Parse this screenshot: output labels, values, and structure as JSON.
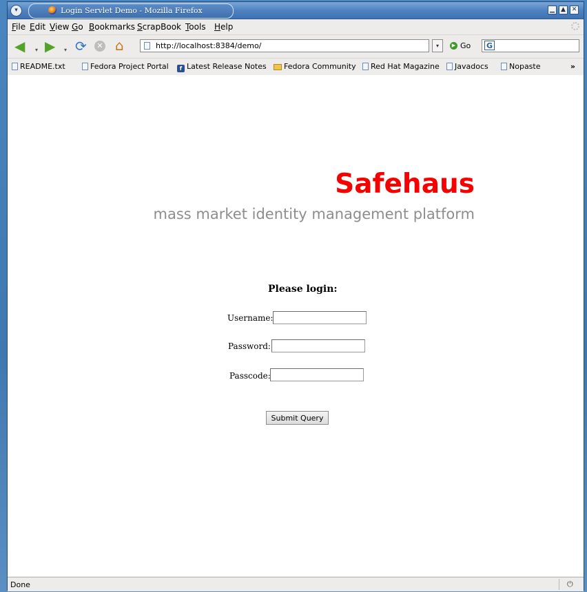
{
  "window": {
    "title": "Login Servlet Demo - Mozilla Firefox",
    "buttons": {
      "minimize": "▁",
      "maximize": "▲",
      "close": "✕"
    }
  },
  "menubar": [
    "File",
    "Edit",
    "View",
    "Go",
    "Bookmarks",
    "ScrapBook",
    "Tools",
    "Help"
  ],
  "navbar": {
    "url": "http://localhost:8384/demo/",
    "go_label": "Go",
    "icons": {
      "back": "◀",
      "forward": "▶",
      "reload": "⟳",
      "stop": "✕",
      "home": "⌂",
      "dropdown": "▾"
    }
  },
  "bookmarks": [
    {
      "label": "README.txt",
      "icon": "page-icon"
    },
    {
      "label": "Fedora Project Portal",
      "icon": "page-icon"
    },
    {
      "label": "Latest Release Notes",
      "icon": "fedora-icon"
    },
    {
      "label": "Fedora Community",
      "icon": "folder-icon"
    },
    {
      "label": "Red Hat Magazine",
      "icon": "page-icon"
    },
    {
      "label": "Javadocs",
      "icon": "feed-icon"
    },
    {
      "label": "Nopaste",
      "icon": "page-icon"
    }
  ],
  "bookmarks_more": "»",
  "page": {
    "brand": "Safehaus",
    "tagline": "mass market identity management platform",
    "login_title": "Please login:",
    "username_label": "Username:",
    "password_label": "Password:",
    "passcode_label": "Passcode:",
    "username_value": "",
    "password_value": "",
    "passcode_value": "",
    "submit_label": "Submit Query",
    "brand_color": "#f70000",
    "tagline_color": "#8d8d8d"
  },
  "status": {
    "text": "Done"
  }
}
